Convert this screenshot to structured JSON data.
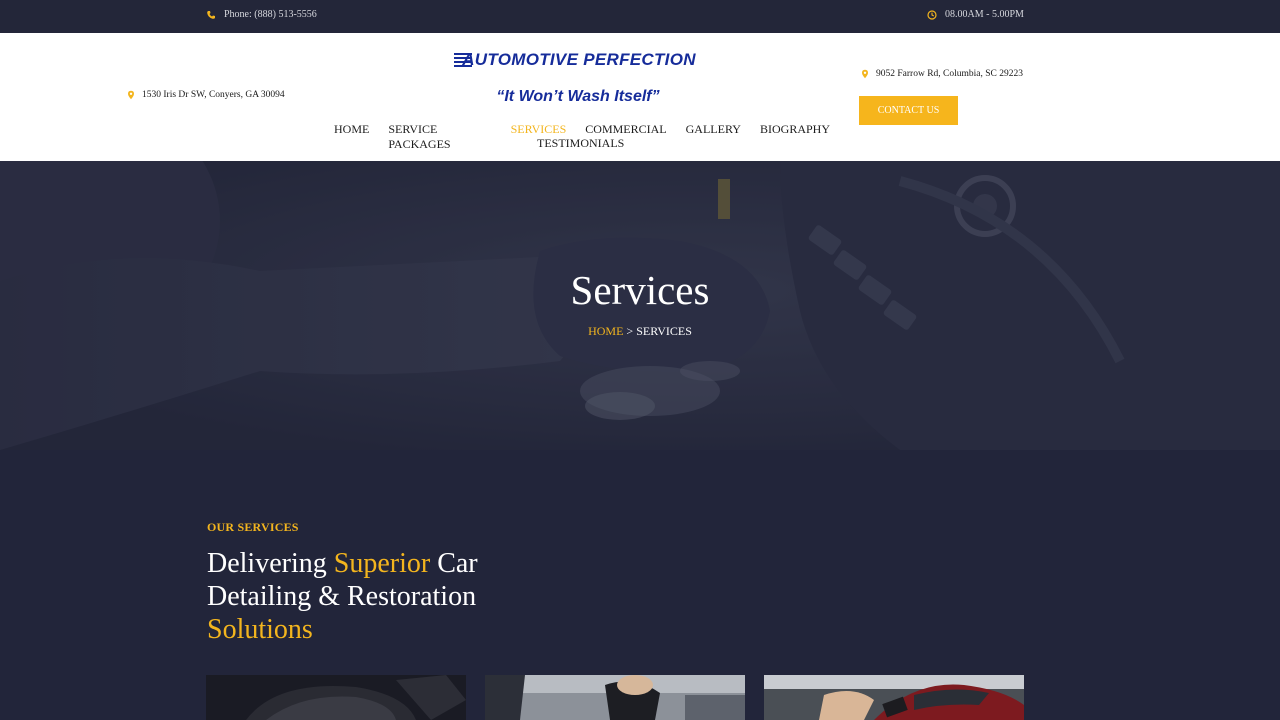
{
  "topbar": {
    "phone": "Phone: (888) 513-5556",
    "hours": "08.00AM - 5.00PM"
  },
  "header": {
    "address_left": "1530 Iris Dr SW, Conyers, GA 30094",
    "address_right": "9052 Farrow Rd, Columbia, SC 29223",
    "logo_text": "AUTOMOTIVE PERFECTION",
    "tagline": "“It Won’t Wash Itself”",
    "contact_button": "CONTACT US"
  },
  "nav": {
    "items": [
      "HOME",
      "SERVICE PACKAGES",
      "SERVICES",
      "COMMERCIAL",
      "GALLERY",
      "BIOGRAPHY",
      "TESTIMONIALS"
    ],
    "active": "SERVICES"
  },
  "hero": {
    "title": "Services",
    "breadcrumb_home": "HOME",
    "breadcrumb_separator": " > ",
    "breadcrumb_current": "SERVICES"
  },
  "services_section": {
    "eyebrow": "OUR SERVICES",
    "heading_part1": "Delivering ",
    "heading_highlight1": "Superior",
    "heading_part2": " Car Detailing & Restoration ",
    "heading_highlight2": "Solutions"
  },
  "colors": {
    "accent": "#f3b51e",
    "dark_bg": "#22253a",
    "logo_blue": "#162c9a"
  },
  "icons": {
    "phone": "phone-icon",
    "clock": "clock-icon",
    "location": "location-pin-icon"
  }
}
